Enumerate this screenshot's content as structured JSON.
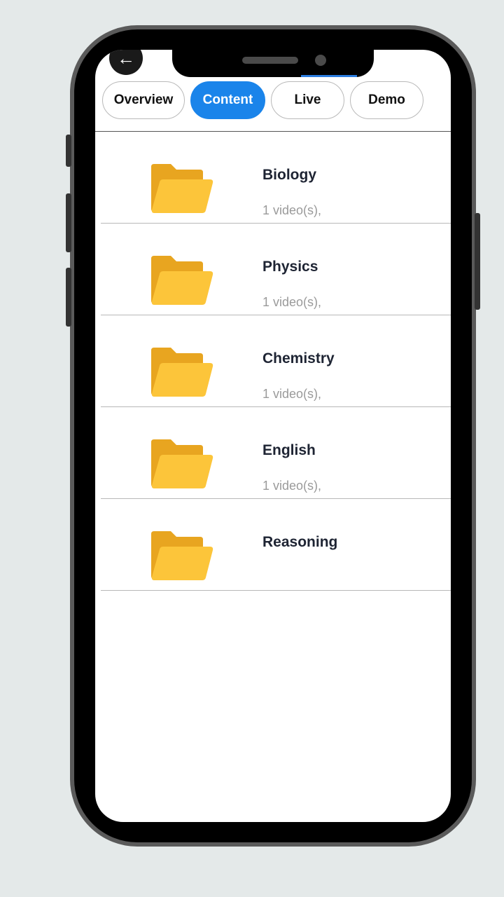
{
  "tabs": [
    {
      "label": "Overview",
      "active": false
    },
    {
      "label": "Content",
      "active": true
    },
    {
      "label": "Live",
      "active": false
    },
    {
      "label": "Demo",
      "active": false
    }
  ],
  "folders": [
    {
      "title": "Biology",
      "subtitle": "1 video(s),"
    },
    {
      "title": "Physics",
      "subtitle": "1 video(s),"
    },
    {
      "title": "Chemistry",
      "subtitle": "1 video(s),"
    },
    {
      "title": "English",
      "subtitle": "1 video(s),"
    },
    {
      "title": "Reasoning",
      "subtitle": ""
    }
  ],
  "icons": {
    "back": "back-arrow-icon",
    "folder": "folder-icon"
  },
  "colors": {
    "accent": "#1a84ea",
    "folder_back": "#e8a520",
    "folder_front": "#fcc53a",
    "title": "#1e2433",
    "subtitle": "#9a9a9a"
  }
}
